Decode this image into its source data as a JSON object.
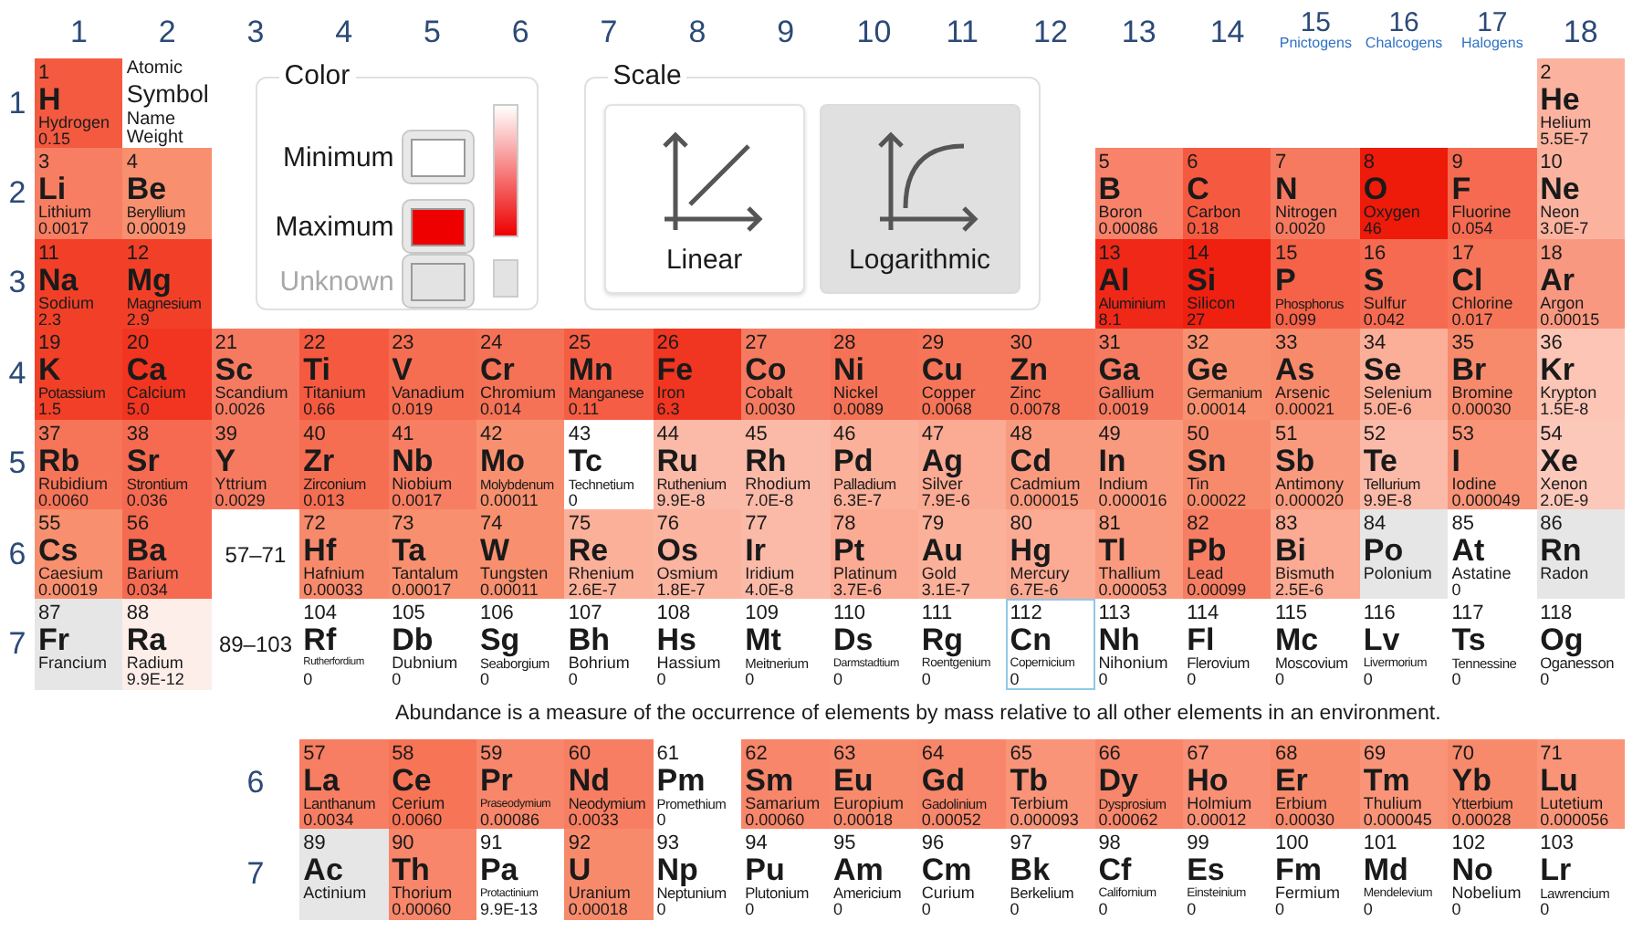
{
  "groups": [
    {
      "label": "1"
    },
    {
      "label": "2"
    },
    {
      "label": "3"
    },
    {
      "label": "4"
    },
    {
      "label": "5"
    },
    {
      "label": "6"
    },
    {
      "label": "7"
    },
    {
      "label": "8"
    },
    {
      "label": "9"
    },
    {
      "label": "10"
    },
    {
      "label": "11"
    },
    {
      "label": "12"
    },
    {
      "label": "13"
    },
    {
      "label": "14"
    },
    {
      "label": "15",
      "family": "Pnictogens"
    },
    {
      "label": "16",
      "family": "Chalcogens"
    },
    {
      "label": "17",
      "family": "Halogens"
    },
    {
      "label": "18"
    }
  ],
  "periods": [
    "1",
    "2",
    "3",
    "4",
    "5",
    "6",
    "7"
  ],
  "key": {
    "number": "Atomic",
    "symbol": "Symbol",
    "name": "Name",
    "value": "Weight"
  },
  "legend": {
    "title": "Color",
    "items": [
      {
        "label": "Minimum",
        "color": "#ffffff",
        "kind": "normal"
      },
      {
        "label": "Maximum",
        "color": "#ee0000",
        "kind": "normal"
      },
      {
        "label": "Unknown",
        "color": "#e3e3e3",
        "kind": "muted"
      }
    ]
  },
  "scale": {
    "title": "Scale",
    "options": [
      {
        "label": "Linear",
        "kind": "linear",
        "selected": false
      },
      {
        "label": "Logarithmic",
        "kind": "log",
        "selected": true
      }
    ]
  },
  "series_labels": [
    "57–71",
    "89–103"
  ],
  "caption": "Abundance is a measure of the occurrence of elements by mass relative to all other elements in an environment.",
  "f_periods": [
    "6",
    "7"
  ],
  "elements": [
    {
      "number": "1",
      "symbol": "H",
      "name": "Hydrogen",
      "value": "0.15",
      "color": "#f45a40",
      "selected": false
    },
    {
      "number": "2",
      "symbol": "He",
      "name": "Helium",
      "value": "5.5E-7",
      "color": "#fbb3a0",
      "selected": false
    },
    {
      "number": "3",
      "symbol": "Li",
      "name": "Lithium",
      "value": "0.0017",
      "color": "#f77e62",
      "selected": false
    },
    {
      "number": "4",
      "symbol": "Be",
      "name": "Beryllium",
      "value": "0.00019",
      "color": "#f89070",
      "selected": false
    },
    {
      "number": "5",
      "symbol": "B",
      "name": "Boron",
      "value": "0.00086",
      "color": "#f8826a",
      "selected": false
    },
    {
      "number": "6",
      "symbol": "C",
      "name": "Carbon",
      "value": "0.18",
      "color": "#f55a40",
      "selected": false
    },
    {
      "number": "7",
      "symbol": "N",
      "name": "Nitrogen",
      "value": "0.0020",
      "color": "#f67a60",
      "selected": false
    },
    {
      "number": "8",
      "symbol": "O",
      "name": "Oxygen",
      "value": "46",
      "color": "#ee1a0a",
      "selected": false
    },
    {
      "number": "9",
      "symbol": "F",
      "name": "Fluorine",
      "value": "0.054",
      "color": "#f56a50",
      "selected": false
    },
    {
      "number": "10",
      "symbol": "Ne",
      "name": "Neon",
      "value": "3.0E-7",
      "color": "#fbb3a0",
      "selected": false
    },
    {
      "number": "11",
      "symbol": "Na",
      "name": "Sodium",
      "value": "2.3",
      "color": "#f24028",
      "selected": false
    },
    {
      "number": "12",
      "symbol": "Mg",
      "name": "Magnesium",
      "value": "2.9",
      "color": "#f24028",
      "selected": false
    },
    {
      "number": "13",
      "symbol": "Al",
      "name": "Aluminium",
      "value": "8.1",
      "color": "#f02818",
      "selected": false
    },
    {
      "number": "14",
      "symbol": "Si",
      "name": "Silicon",
      "value": "27",
      "color": "#ef2010",
      "selected": false
    },
    {
      "number": "15",
      "symbol": "P",
      "name": "Phosphorus",
      "value": "0.099",
      "color": "#f56248",
      "selected": false
    },
    {
      "number": "16",
      "symbol": "S",
      "name": "Sulfur",
      "value": "0.042",
      "color": "#f56a50",
      "selected": false
    },
    {
      "number": "17",
      "symbol": "Cl",
      "name": "Chlorine",
      "value": "0.017",
      "color": "#f67558",
      "selected": false
    },
    {
      "number": "18",
      "symbol": "Ar",
      "name": "Argon",
      "value": "0.00015",
      "color": "#f99880",
      "selected": false
    },
    {
      "number": "19",
      "symbol": "K",
      "name": "Potassium",
      "value": "1.5",
      "color": "#f24028",
      "selected": false
    },
    {
      "number": "20",
      "symbol": "Ca",
      "name": "Calcium",
      "value": "5.0",
      "color": "#f13520",
      "selected": false
    },
    {
      "number": "21",
      "symbol": "Sc",
      "name": "Scandium",
      "value": "0.0026",
      "color": "#f67a60",
      "selected": false
    },
    {
      "number": "22",
      "symbol": "Ti",
      "name": "Titanium",
      "value": "0.66",
      "color": "#f55a40",
      "selected": false
    },
    {
      "number": "23",
      "symbol": "V",
      "name": "Vanadium",
      "value": "0.019",
      "color": "#f66e52",
      "selected": false
    },
    {
      "number": "24",
      "symbol": "Cr",
      "name": "Chromium",
      "value": "0.014",
      "color": "#f67256",
      "selected": false
    },
    {
      "number": "25",
      "symbol": "Mn",
      "name": "Manganese",
      "value": "0.11",
      "color": "#f55e44",
      "selected": false
    },
    {
      "number": "26",
      "symbol": "Fe",
      "name": "Iron",
      "value": "6.3",
      "color": "#f03520",
      "selected": false
    },
    {
      "number": "27",
      "symbol": "Co",
      "name": "Cobalt",
      "value": "0.0030",
      "color": "#f67a60",
      "selected": false
    },
    {
      "number": "28",
      "symbol": "Ni",
      "name": "Nickel",
      "value": "0.0089",
      "color": "#f67256",
      "selected": false
    },
    {
      "number": "29",
      "symbol": "Cu",
      "name": "Copper",
      "value": "0.0068",
      "color": "#f67458",
      "selected": false
    },
    {
      "number": "30",
      "symbol": "Zn",
      "name": "Zinc",
      "value": "0.0078",
      "color": "#f67458",
      "selected": false
    },
    {
      "number": "31",
      "symbol": "Ga",
      "name": "Gallium",
      "value": "0.0019",
      "color": "#f67a60",
      "selected": false
    },
    {
      "number": "32",
      "symbol": "Ge",
      "name": "Germanium",
      "value": "0.00014",
      "color": "#f8906f",
      "selected": false
    },
    {
      "number": "33",
      "symbol": "As",
      "name": "Arsenic",
      "value": "0.00021",
      "color": "#f88a6c",
      "selected": false
    },
    {
      "number": "34",
      "symbol": "Se",
      "name": "Selenium",
      "value": "5.0E-6",
      "color": "#fbae98",
      "selected": false
    },
    {
      "number": "35",
      "symbol": "Br",
      "name": "Bromine",
      "value": "0.00030",
      "color": "#f88a6c",
      "selected": false
    },
    {
      "number": "36",
      "symbol": "Kr",
      "name": "Krypton",
      "value": "1.5E-8",
      "color": "#fcc5b5",
      "selected": false
    },
    {
      "number": "37",
      "symbol": "Rb",
      "name": "Rubidium",
      "value": "0.0060",
      "color": "#f67458",
      "selected": false
    },
    {
      "number": "38",
      "symbol": "Sr",
      "name": "Strontium",
      "value": "0.036",
      "color": "#f56a50",
      "selected": false
    },
    {
      "number": "39",
      "symbol": "Y",
      "name": "Yttrium",
      "value": "0.0029",
      "color": "#f67a60",
      "selected": false
    },
    {
      "number": "40",
      "symbol": "Zr",
      "name": "Zirconium",
      "value": "0.013",
      "color": "#f66e52",
      "selected": false
    },
    {
      "number": "41",
      "symbol": "Nb",
      "name": "Niobium",
      "value": "0.0017",
      "color": "#f77e62",
      "selected": false
    },
    {
      "number": "42",
      "symbol": "Mo",
      "name": "Molybdenum",
      "value": "0.00011",
      "color": "#f8906f",
      "selected": false
    },
    {
      "number": "43",
      "symbol": "Tc",
      "name": "Technetium",
      "value": "0",
      "color": "#ffffff",
      "selected": false
    },
    {
      "number": "44",
      "symbol": "Ru",
      "name": "Ruthenium",
      "value": "9.9E-8",
      "color": "#fbbaa8",
      "selected": false
    },
    {
      "number": "45",
      "symbol": "Rh",
      "name": "Rhodium",
      "value": "7.0E-8",
      "color": "#fbbaa8",
      "selected": false
    },
    {
      "number": "46",
      "symbol": "Pd",
      "name": "Palladium",
      "value": "6.3E-7",
      "color": "#fbb09a",
      "selected": false
    },
    {
      "number": "47",
      "symbol": "Ag",
      "name": "Silver",
      "value": "7.9E-6",
      "color": "#fbaa94",
      "selected": false
    },
    {
      "number": "48",
      "symbol": "Cd",
      "name": "Cadmium",
      "value": "0.000015",
      "color": "#f99a7e",
      "selected": false
    },
    {
      "number": "49",
      "symbol": "In",
      "name": "Indium",
      "value": "0.000016",
      "color": "#f99a7e",
      "selected": false
    },
    {
      "number": "50",
      "symbol": "Sn",
      "name": "Tin",
      "value": "0.00022",
      "color": "#f88a6c",
      "selected": false
    },
    {
      "number": "51",
      "symbol": "Sb",
      "name": "Antimony",
      "value": "0.000020",
      "color": "#f99a7e",
      "selected": false
    },
    {
      "number": "52",
      "symbol": "Te",
      "name": "Tellurium",
      "value": "9.9E-8",
      "color": "#fbbaa8",
      "selected": false
    },
    {
      "number": "53",
      "symbol": "I",
      "name": "Iodine",
      "value": "0.000049",
      "color": "#f99478",
      "selected": false
    },
    {
      "number": "54",
      "symbol": "Xe",
      "name": "Xenon",
      "value": "2.0E-9",
      "color": "#fcc8ba",
      "selected": false
    },
    {
      "number": "55",
      "symbol": "Cs",
      "name": "Caesium",
      "value": "0.00019",
      "color": "#f8906f",
      "selected": false
    },
    {
      "number": "56",
      "symbol": "Ba",
      "name": "Barium",
      "value": "0.034",
      "color": "#f56a50",
      "selected": false
    },
    {
      "number": "57",
      "symbol": "La",
      "name": "Lanthanum",
      "value": "0.0034",
      "color": "#f77e62",
      "selected": false
    },
    {
      "number": "58",
      "symbol": "Ce",
      "name": "Cerium",
      "value": "0.0060",
      "color": "#f77456",
      "selected": false
    },
    {
      "number": "59",
      "symbol": "Pr",
      "name": "Praseodymium",
      "value": "0.00086",
      "color": "#f8866a",
      "selected": false
    },
    {
      "number": "60",
      "symbol": "Nd",
      "name": "Neodymium",
      "value": "0.0033",
      "color": "#f77e62",
      "selected": false
    },
    {
      "number": "61",
      "symbol": "Pm",
      "name": "Promethium",
      "value": "0",
      "color": "#ffffff",
      "selected": false
    },
    {
      "number": "62",
      "symbol": "Sm",
      "name": "Samarium",
      "value": "0.00060",
      "color": "#f8866a",
      "selected": false
    },
    {
      "number": "63",
      "symbol": "Eu",
      "name": "Europium",
      "value": "0.00018",
      "color": "#f88a6c",
      "selected": false
    },
    {
      "number": "64",
      "symbol": "Gd",
      "name": "Gadolinium",
      "value": "0.00052",
      "color": "#f8866a",
      "selected": false
    },
    {
      "number": "65",
      "symbol": "Tb",
      "name": "Terbium",
      "value": "0.000093",
      "color": "#f99478",
      "selected": false
    },
    {
      "number": "66",
      "symbol": "Dy",
      "name": "Dysprosium",
      "value": "0.00062",
      "color": "#f8866a",
      "selected": false
    },
    {
      "number": "67",
      "symbol": "Ho",
      "name": "Holmium",
      "value": "0.00012",
      "color": "#f99076",
      "selected": false
    },
    {
      "number": "68",
      "symbol": "Er",
      "name": "Erbium",
      "value": "0.00030",
      "color": "#f88a6c",
      "selected": false
    },
    {
      "number": "69",
      "symbol": "Tm",
      "name": "Thulium",
      "value": "0.000045",
      "color": "#f99478",
      "selected": false
    },
    {
      "number": "70",
      "symbol": "Yb",
      "name": "Ytterbium",
      "value": "0.00028",
      "color": "#f88a6c",
      "selected": false
    },
    {
      "number": "71",
      "symbol": "Lu",
      "name": "Lutetium",
      "value": "0.000056",
      "color": "#f99478",
      "selected": false
    },
    {
      "number": "72",
      "symbol": "Hf",
      "name": "Hafnium",
      "value": "0.00033",
      "color": "#f88a6c",
      "selected": false
    },
    {
      "number": "73",
      "symbol": "Ta",
      "name": "Tantalum",
      "value": "0.00017",
      "color": "#f8906f",
      "selected": false
    },
    {
      "number": "74",
      "symbol": "W",
      "name": "Tungsten",
      "value": "0.00011",
      "color": "#f8906f",
      "selected": false
    },
    {
      "number": "75",
      "symbol": "Re",
      "name": "Rhenium",
      "value": "2.6E-7",
      "color": "#fbb09a",
      "selected": false
    },
    {
      "number": "76",
      "symbol": "Os",
      "name": "Osmium",
      "value": "1.8E-7",
      "color": "#fbb4a0",
      "selected": false
    },
    {
      "number": "77",
      "symbol": "Ir",
      "name": "Iridium",
      "value": "4.0E-8",
      "color": "#fbbaa8",
      "selected": false
    },
    {
      "number": "78",
      "symbol": "Pt",
      "name": "Platinum",
      "value": "3.7E-6",
      "color": "#fbaa94",
      "selected": false
    },
    {
      "number": "79",
      "symbol": "Au",
      "name": "Gold",
      "value": "3.1E-7",
      "color": "#fbb09a",
      "selected": false
    },
    {
      "number": "80",
      "symbol": "Hg",
      "name": "Mercury",
      "value": "6.7E-6",
      "color": "#fbaa94",
      "selected": false
    },
    {
      "number": "81",
      "symbol": "Tl",
      "name": "Thallium",
      "value": "0.000053",
      "color": "#f99a7e",
      "selected": false
    },
    {
      "number": "82",
      "symbol": "Pb",
      "name": "Lead",
      "value": "0.00099",
      "color": "#f77e62",
      "selected": false
    },
    {
      "number": "83",
      "symbol": "Bi",
      "name": "Bismuth",
      "value": "2.5E-6",
      "color": "#fbaa94",
      "selected": false
    },
    {
      "number": "84",
      "symbol": "Po",
      "name": "Polonium",
      "color": "#e6e6e6",
      "selected": false
    },
    {
      "number": "85",
      "symbol": "At",
      "name": "Astatine",
      "value": "0",
      "color": "#ffffff",
      "selected": false
    },
    {
      "number": "86",
      "symbol": "Rn",
      "name": "Radon",
      "color": "#e6e6e6",
      "selected": false
    },
    {
      "number": "87",
      "symbol": "Fr",
      "name": "Francium",
      "color": "#e6e6e6",
      "selected": false
    },
    {
      "number": "88",
      "symbol": "Ra",
      "name": "Radium",
      "value": "9.9E-12",
      "color": "#fdeee9",
      "selected": false
    },
    {
      "number": "89",
      "symbol": "Ac",
      "name": "Actinium",
      "color": "#e6e6e6",
      "selected": false
    },
    {
      "number": "90",
      "symbol": "Th",
      "name": "Thorium",
      "value": "0.00060",
      "color": "#f8866a",
      "selected": false
    },
    {
      "number": "91",
      "symbol": "Pa",
      "name": "Protactinium",
      "value": "9.9E-13",
      "color": "#ffffff",
      "selected": false
    },
    {
      "number": "92",
      "symbol": "U",
      "name": "Uranium",
      "value": "0.00018",
      "color": "#f88a6c",
      "selected": false
    },
    {
      "number": "93",
      "symbol": "Np",
      "name": "Neptunium",
      "value": "0",
      "color": "#ffffff",
      "selected": false
    },
    {
      "number": "94",
      "symbol": "Pu",
      "name": "Plutonium",
      "value": "0",
      "color": "#ffffff",
      "selected": false
    },
    {
      "number": "95",
      "symbol": "Am",
      "name": "Americium",
      "value": "0",
      "color": "#ffffff",
      "selected": false
    },
    {
      "number": "96",
      "symbol": "Cm",
      "name": "Curium",
      "value": "0",
      "color": "#ffffff",
      "selected": false
    },
    {
      "number": "97",
      "symbol": "Bk",
      "name": "Berkelium",
      "value": "0",
      "color": "#ffffff",
      "selected": false
    },
    {
      "number": "98",
      "symbol": "Cf",
      "name": "Californium",
      "value": "0",
      "color": "#ffffff",
      "selected": false
    },
    {
      "number": "99",
      "symbol": "Es",
      "name": "Einsteinium",
      "value": "0",
      "color": "#ffffff",
      "selected": false
    },
    {
      "number": "100",
      "symbol": "Fm",
      "name": "Fermium",
      "value": "0",
      "color": "#ffffff",
      "selected": false
    },
    {
      "number": "101",
      "symbol": "Md",
      "name": "Mendelevium",
      "value": "0",
      "color": "#ffffff",
      "selected": false
    },
    {
      "number": "102",
      "symbol": "No",
      "name": "Nobelium",
      "value": "0",
      "color": "#ffffff",
      "selected": false
    },
    {
      "number": "103",
      "symbol": "Lr",
      "name": "Lawrencium",
      "value": "0",
      "color": "#ffffff",
      "selected": false
    },
    {
      "number": "104",
      "symbol": "Rf",
      "name": "Rutherfordium",
      "value": "0",
      "color": "#ffffff",
      "selected": false
    },
    {
      "number": "105",
      "symbol": "Db",
      "name": "Dubnium",
      "value": "0",
      "color": "#ffffff",
      "selected": false
    },
    {
      "number": "106",
      "symbol": "Sg",
      "name": "Seaborgium",
      "value": "0",
      "color": "#ffffff",
      "selected": false
    },
    {
      "number": "107",
      "symbol": "Bh",
      "name": "Bohrium",
      "value": "0",
      "color": "#ffffff",
      "selected": false
    },
    {
      "number": "108",
      "symbol": "Hs",
      "name": "Hassium",
      "value": "0",
      "color": "#ffffff",
      "selected": false
    },
    {
      "number": "109",
      "symbol": "Mt",
      "name": "Meitnerium",
      "value": "0",
      "color": "#ffffff",
      "selected": false
    },
    {
      "number": "110",
      "symbol": "Ds",
      "name": "Darmstadtium",
      "value": "0",
      "color": "#ffffff",
      "selected": false
    },
    {
      "number": "111",
      "symbol": "Rg",
      "name": "Roentgenium",
      "value": "0",
      "color": "#ffffff",
      "selected": false
    },
    {
      "number": "112",
      "symbol": "Cn",
      "name": "Copernicium",
      "value": "0",
      "color": "#ffffff",
      "selected": true
    },
    {
      "number": "113",
      "symbol": "Nh",
      "name": "Nihonium",
      "value": "0",
      "color": "#ffffff",
      "selected": false
    },
    {
      "number": "114",
      "symbol": "Fl",
      "name": "Flerovium",
      "value": "0",
      "color": "#ffffff",
      "selected": false
    },
    {
      "number": "115",
      "symbol": "Mc",
      "name": "Moscovium",
      "value": "0",
      "color": "#ffffff",
      "selected": false
    },
    {
      "number": "116",
      "symbol": "Lv",
      "name": "Livermorium",
      "value": "0",
      "color": "#ffffff",
      "selected": false
    },
    {
      "number": "117",
      "symbol": "Ts",
      "name": "Tennessine",
      "value": "0",
      "color": "#ffffff",
      "selected": false
    },
    {
      "number": "118",
      "symbol": "Og",
      "name": "Oganesson",
      "value": "0",
      "color": "#ffffff",
      "selected": false
    }
  ]
}
